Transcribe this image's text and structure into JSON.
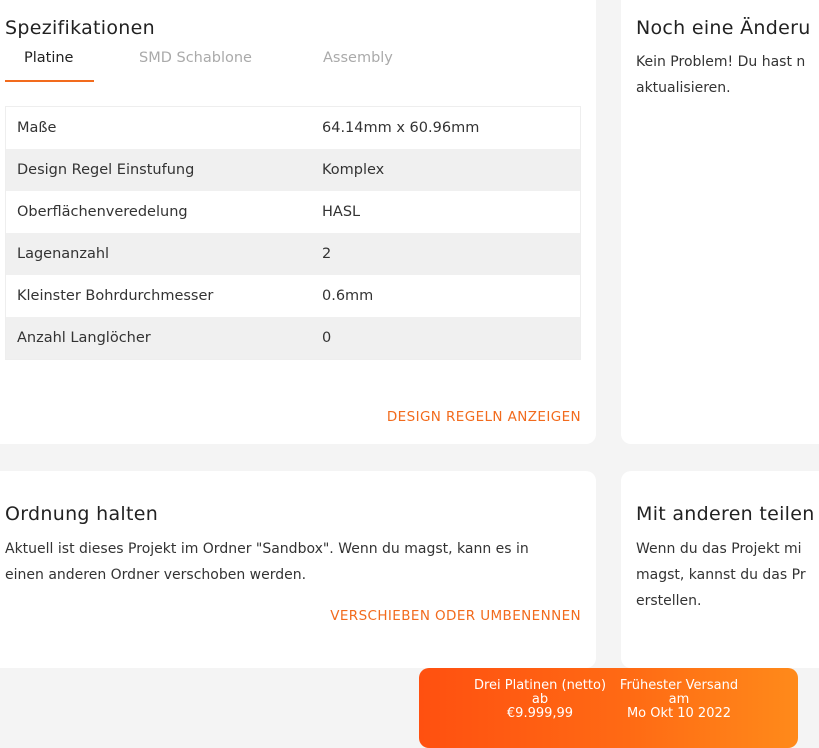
{
  "specs": {
    "title": "Spezifikationen",
    "tabs": [
      {
        "label": "Platine",
        "active": true
      },
      {
        "label": "SMD Schablone",
        "active": false
      },
      {
        "label": "Assembly",
        "active": false
      }
    ],
    "rows": [
      {
        "label": "Maße",
        "value": "64.14mm x 60.96mm"
      },
      {
        "label": "Design Regel Einstufung",
        "value": "Komplex"
      },
      {
        "label": "Oberflächenveredelung",
        "value": "HASL"
      },
      {
        "label": "Lagenanzahl",
        "value": "2"
      },
      {
        "label": "Kleinster Bohrdurchmesser",
        "value": "0.6mm"
      },
      {
        "label": "Anzahl Langlöcher",
        "value": "0"
      }
    ],
    "design_rules_link": "DESIGN REGELN ANZEIGEN"
  },
  "change": {
    "title": "Noch eine Änderu",
    "lines": [
      "Kein Problem! Du hast n",
      "aktualisieren."
    ]
  },
  "order": {
    "title": "Ordnung halten",
    "lines": [
      "Aktuell ist dieses Projekt im Ordner \"Sandbox\". Wenn du magst, kann es in",
      "einen anderen Ordner verschoben werden."
    ],
    "move_link": "VERSCHIEBEN ODER UMBENENNEN"
  },
  "share": {
    "title": "Mit anderen teilen",
    "lines": [
      "Wenn du das Projekt mi",
      "magst, kannst du das Pr",
      "erstellen."
    ]
  },
  "price_bar": {
    "price_label": "Drei Platinen (netto)",
    "price_prefix": "ab",
    "price_value": "€9.999,99",
    "ship_label": "Frühester Versand",
    "ship_prefix": "am",
    "ship_value": "Mo Okt 10 2022"
  },
  "colors": {
    "accent": "#f26b1d",
    "bar_start": "#ff5010",
    "bar_end": "#ff8a1a"
  }
}
